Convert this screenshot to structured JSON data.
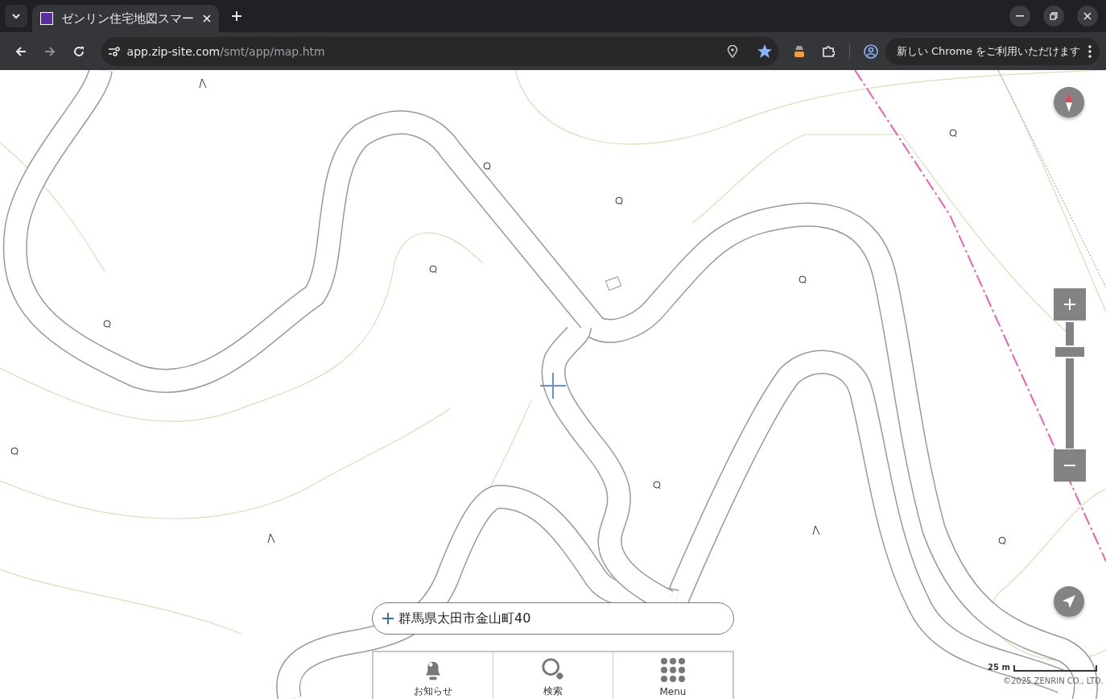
{
  "browser": {
    "tab": {
      "title": "ゼンリン住宅地図スマー",
      "selected": true
    },
    "address": {
      "host": "app.zip-site.com",
      "path": "/smt/app/map.htm"
    },
    "bookmarked": true,
    "update_button": "新しい Chrome をご利用いただけます"
  },
  "map": {
    "zoom": {
      "level": 0.78
    },
    "address_bar": "群馬県太田市金山町40",
    "nav": [
      {
        "label": "お知らせ",
        "kind": "bell"
      },
      {
        "label": "検索",
        "kind": "search"
      },
      {
        "label": "Menu",
        "kind": "grid"
      }
    ],
    "scale": "25 m",
    "copyright": "©2025 ZENRIN CO., LTD."
  }
}
